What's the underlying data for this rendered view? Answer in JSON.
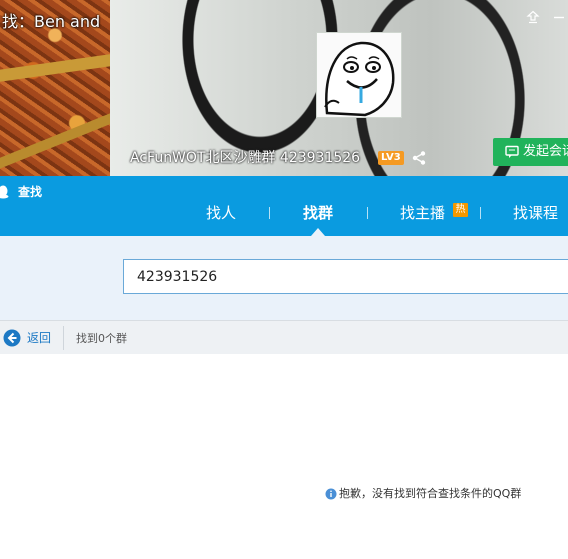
{
  "banner": {
    "video_caption": "找：Ben and",
    "group_title": "AcFunWOT北区沙雕群 423931526",
    "level_badge": "LV3",
    "launch_button": "发起会话"
  },
  "header": {
    "brand": "查找",
    "tabs": [
      {
        "label": "找人"
      },
      {
        "label": "找群"
      },
      {
        "label": "找主播",
        "badge": "热"
      },
      {
        "label": "找课程"
      }
    ]
  },
  "search": {
    "value": "423931526"
  },
  "results": {
    "back_label": "返回",
    "count_text": "找到0个群",
    "empty_message": "抱歉，没有找到符合查找条件的QQ群"
  },
  "colors": {
    "header_blue": "#0a9be0",
    "launch_green": "#21b35b",
    "badge_orange": "#f39800",
    "link_blue": "#1d79c4"
  },
  "icons": [
    "pin-icon",
    "minimize-icon",
    "share-icon",
    "chat-icon",
    "qq-penguin-icon",
    "back-arrow-icon",
    "info-icon"
  ]
}
